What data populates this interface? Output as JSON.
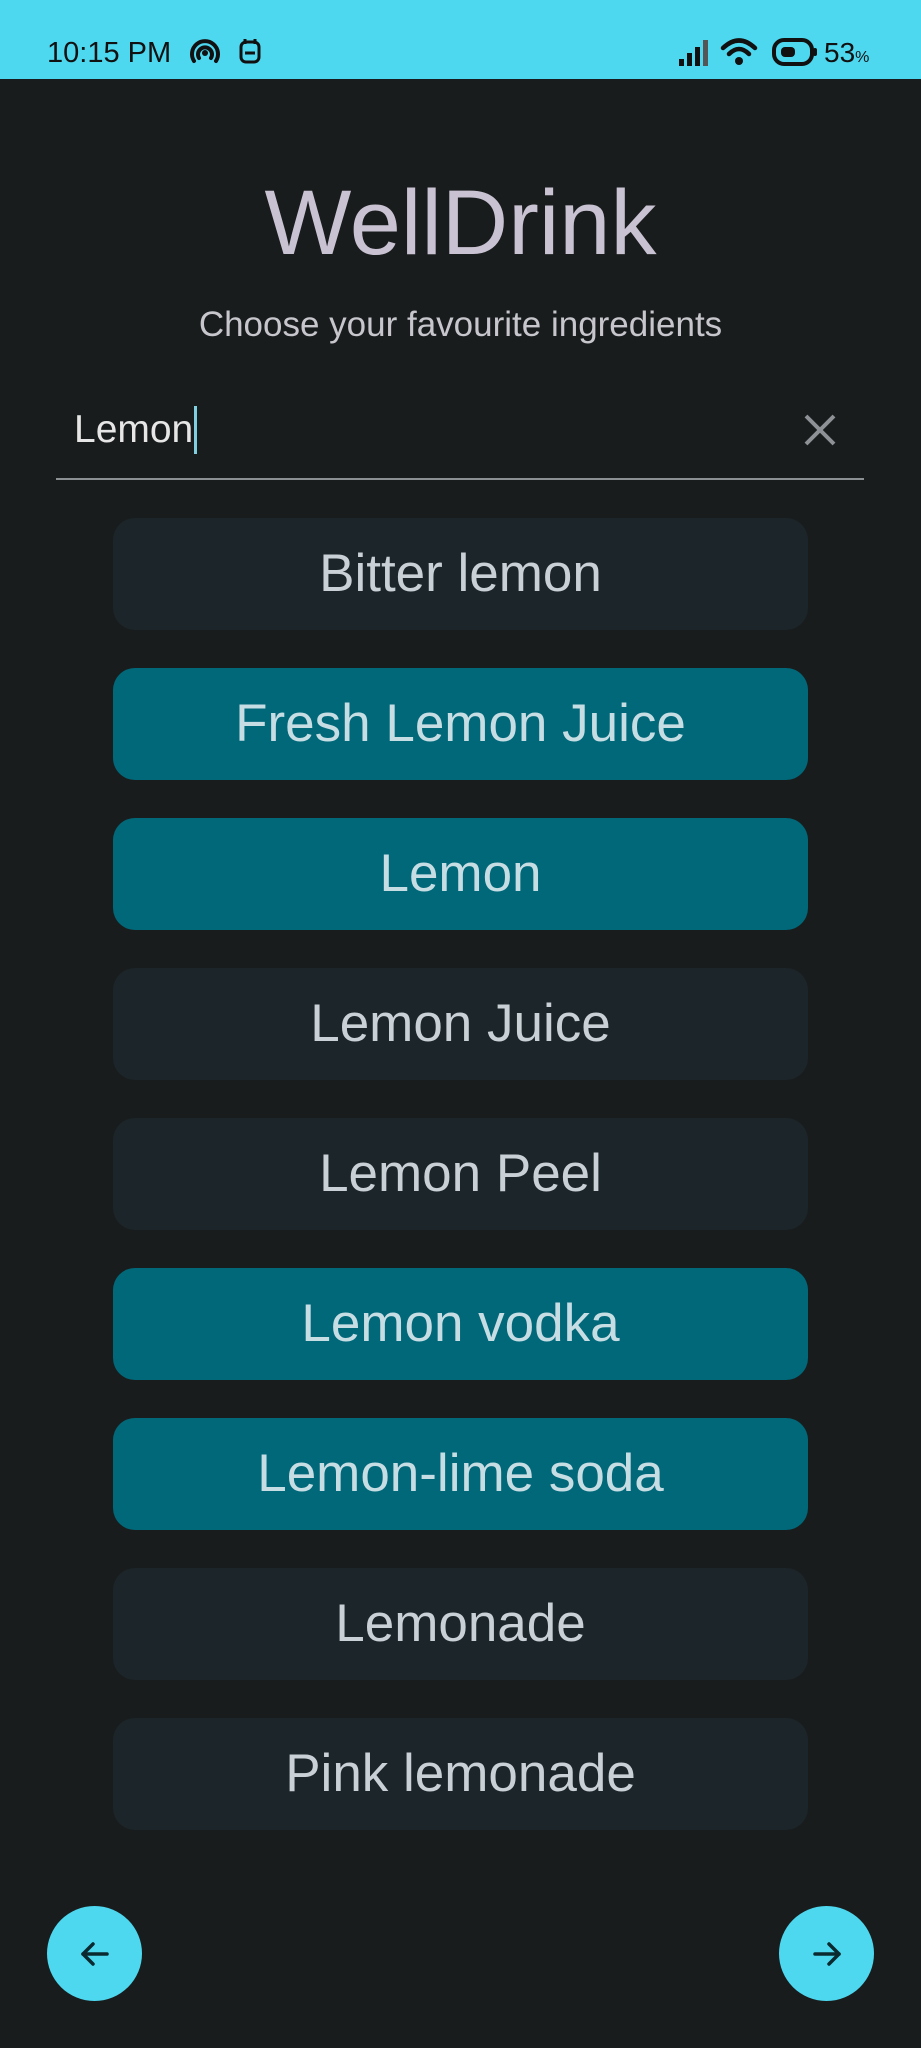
{
  "status_bar": {
    "time": "10:15 PM",
    "battery_percent": "53",
    "battery_unit": "%",
    "icons": [
      "hotspot-icon",
      "notification-icon",
      "signal-icon",
      "wifi-icon",
      "battery-icon"
    ]
  },
  "header": {
    "title": "WellDrink",
    "subtitle": "Choose your favourite ingredients"
  },
  "search": {
    "value": "Lemon",
    "clear_icon": "close-icon"
  },
  "ingredients": [
    {
      "label": "Bitter lemon",
      "selected": false
    },
    {
      "label": "Fresh Lemon Juice",
      "selected": true
    },
    {
      "label": "Lemon",
      "selected": true
    },
    {
      "label": "Lemon Juice",
      "selected": false
    },
    {
      "label": "Lemon Peel",
      "selected": false
    },
    {
      "label": "Lemon vodka",
      "selected": true
    },
    {
      "label": "Lemon-lime soda",
      "selected": true
    },
    {
      "label": "Lemonade",
      "selected": false
    },
    {
      "label": "Pink lemonade",
      "selected": false
    }
  ],
  "navigation": {
    "back_icon": "arrow-left-icon",
    "next_icon": "arrow-right-icon"
  },
  "colors": {
    "background": "#191c1d",
    "accent": "#4dd8f0",
    "chip_selected": "#006879",
    "chip_unselected": "#1c2529",
    "title_text": "#c9c2d2"
  }
}
